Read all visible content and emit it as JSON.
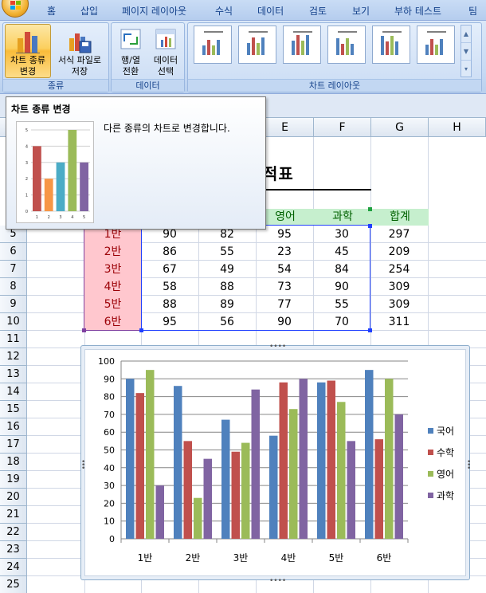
{
  "menu": {
    "tabs": [
      "홈",
      "삽입",
      "페이지 레이아웃",
      "수식",
      "데이터",
      "검토",
      "보기",
      "부하 테스트",
      "팀"
    ]
  },
  "ribbon": {
    "groups": {
      "type": {
        "label": "종류",
        "change_chart_type": "차트 종류\n변경",
        "save_template": "서식 파일로\n저장"
      },
      "data": {
        "label": "데이터",
        "switch_row_col": "행/열\n전환",
        "select_data": "데이터\n선택"
      },
      "layouts": {
        "label": "차트 레이아웃"
      }
    }
  },
  "tooltip": {
    "title": "차트 종류 변경",
    "description": "다른 종류의 차트로 변경합니다."
  },
  "sheet": {
    "columns": [
      "E",
      "F",
      "G",
      "H"
    ],
    "rows": [
      "5",
      "6",
      "7",
      "8",
      "9",
      "10",
      "11",
      "12",
      "13",
      "14",
      "15",
      "16",
      "17",
      "18",
      "19",
      "20",
      "21",
      "22",
      "23",
      "24",
      "25"
    ],
    "title": "적표",
    "headers": [
      "영어",
      "과학",
      "합계"
    ],
    "table": [
      [
        "1반",
        "90",
        "82",
        "95",
        "30",
        "297"
      ],
      [
        "2반",
        "86",
        "55",
        "23",
        "45",
        "209"
      ],
      [
        "3반",
        "67",
        "49",
        "54",
        "84",
        "254"
      ],
      [
        "4반",
        "58",
        "88",
        "73",
        "90",
        "309"
      ],
      [
        "5반",
        "88",
        "89",
        "77",
        "55",
        "309"
      ],
      [
        "6반",
        "95",
        "56",
        "90",
        "70",
        "311"
      ]
    ]
  },
  "colors": {
    "korean": "#4f81bd",
    "math": "#c0504d",
    "english": "#9bbb59",
    "science": "#8064a2",
    "header_fill": "#c6efce",
    "label_fill": "#ffc7ce"
  },
  "chart_data": {
    "type": "bar",
    "categories": [
      "1반",
      "2반",
      "3반",
      "4반",
      "5반",
      "6반"
    ],
    "series": [
      {
        "name": "국어",
        "values": [
          90,
          86,
          67,
          58,
          88,
          95
        ]
      },
      {
        "name": "수학",
        "values": [
          82,
          55,
          49,
          88,
          89,
          56
        ]
      },
      {
        "name": "영어",
        "values": [
          95,
          23,
          54,
          73,
          77,
          90
        ]
      },
      {
        "name": "과학",
        "values": [
          30,
          45,
          84,
          90,
          55,
          70
        ]
      }
    ],
    "ylim": [
      0,
      100
    ],
    "yticks": [
      "0",
      "10",
      "20",
      "30",
      "40",
      "50",
      "60",
      "70",
      "80",
      "90",
      "100"
    ],
    "grid": true,
    "legend": "right"
  },
  "tooltip_preview": {
    "yticks": [
      "0",
      "1",
      "2",
      "3",
      "4",
      "5"
    ],
    "categories": [
      "1",
      "2",
      "3",
      "4",
      "5"
    ],
    "values": [
      4,
      2,
      3,
      5,
      3
    ],
    "colors": [
      "#c0504d",
      "#f79646",
      "#4bacc6",
      "#9bbb59",
      "#8064a2"
    ]
  }
}
